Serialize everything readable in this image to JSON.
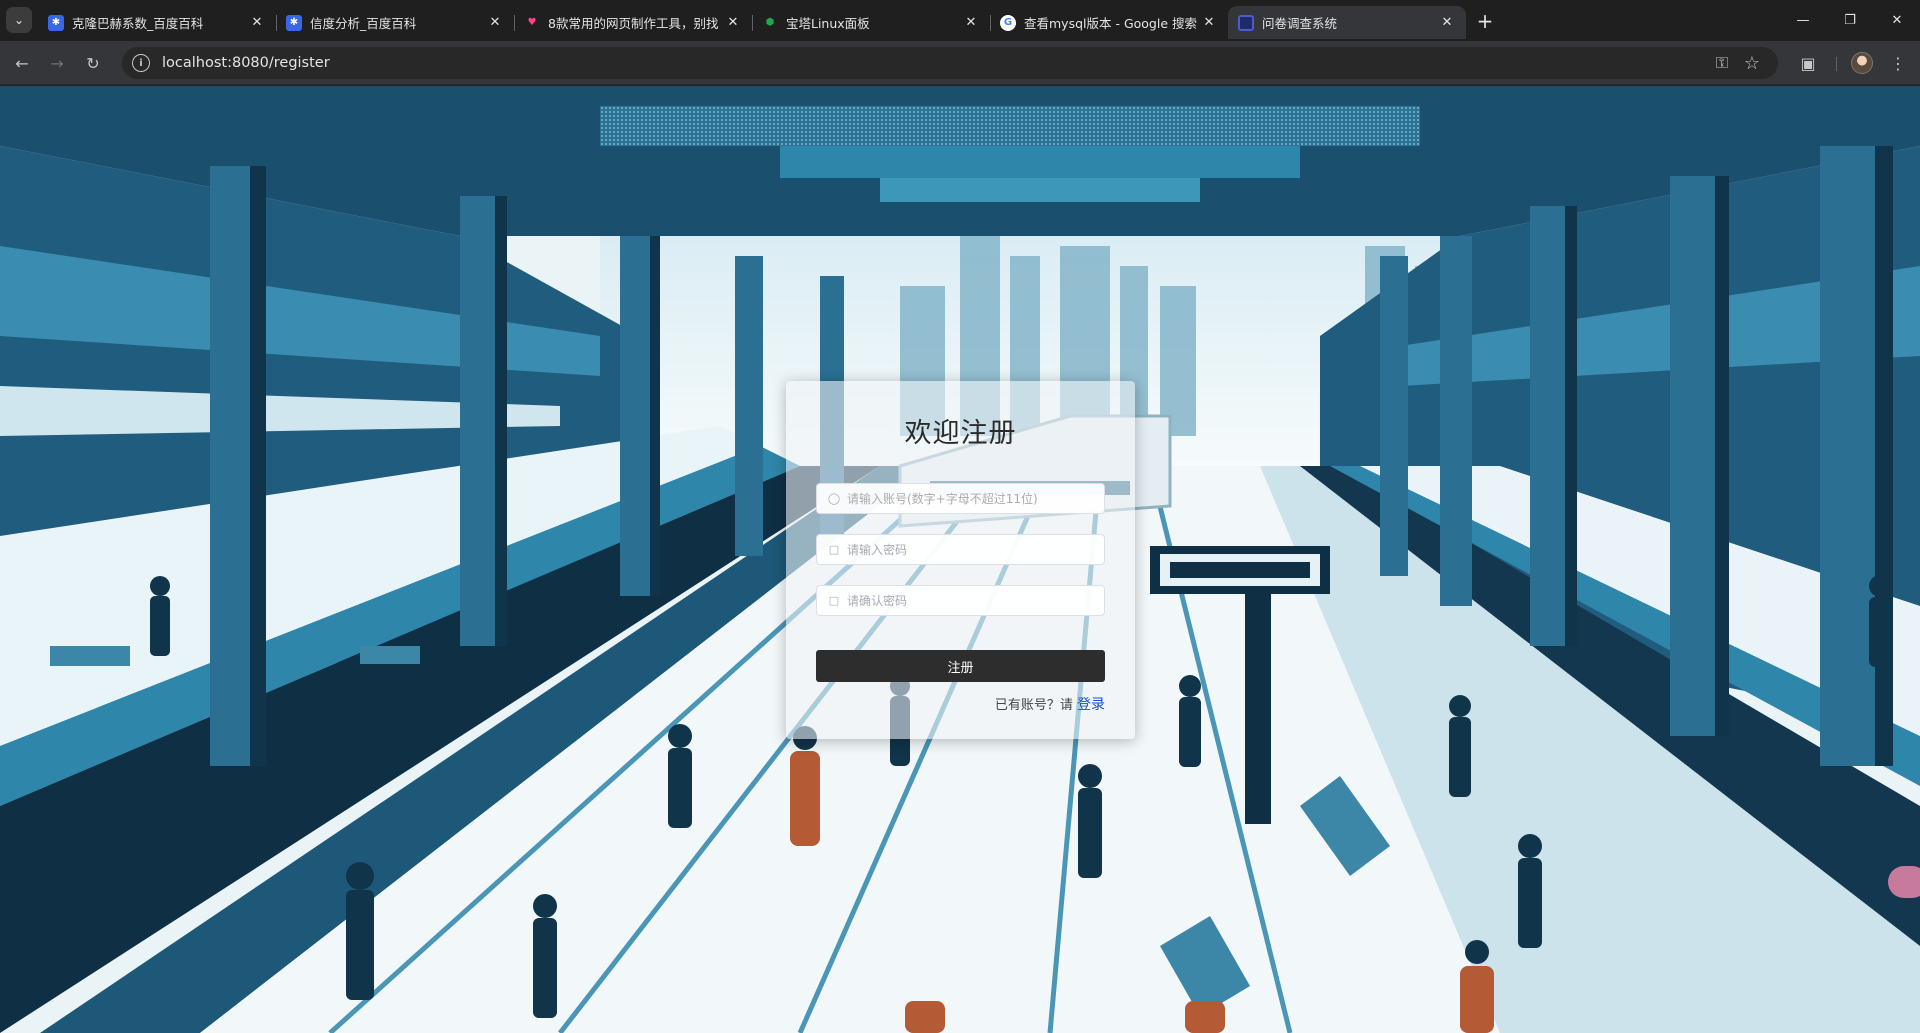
{
  "browser": {
    "tabs": [
      {
        "title": "克隆巴赫系数_百度百科",
        "favicon": "baidu-icon",
        "active": false
      },
      {
        "title": "信度分析_百度百科",
        "favicon": "baidu-icon",
        "active": false
      },
      {
        "title": "8款常用的网页制作工具，别找",
        "favicon": "pink-brand-icon",
        "active": false
      },
      {
        "title": "宝塔Linux面板",
        "favicon": "bt-shield-icon",
        "active": false
      },
      {
        "title": "查看mysql版本 - Google 搜索",
        "favicon": "google-icon",
        "active": false
      },
      {
        "title": "问卷调查系统",
        "favicon": "document-icon",
        "active": true
      }
    ],
    "url": "localhost:8080/register"
  },
  "register": {
    "title": "欢迎注册",
    "account_placeholder": "请输入账号(数字+字母不超过11位)",
    "password_placeholder": "请输入密码",
    "confirm_placeholder": "请确认密码",
    "submit_label": "注册",
    "login_prompt": "已有账号？请",
    "login_link": "登录"
  },
  "colors": {
    "button": "#2d2d2d",
    "link": "#1d4fd7",
    "tab_active": "#35363a",
    "tabstrip": "#1f1f1f"
  }
}
